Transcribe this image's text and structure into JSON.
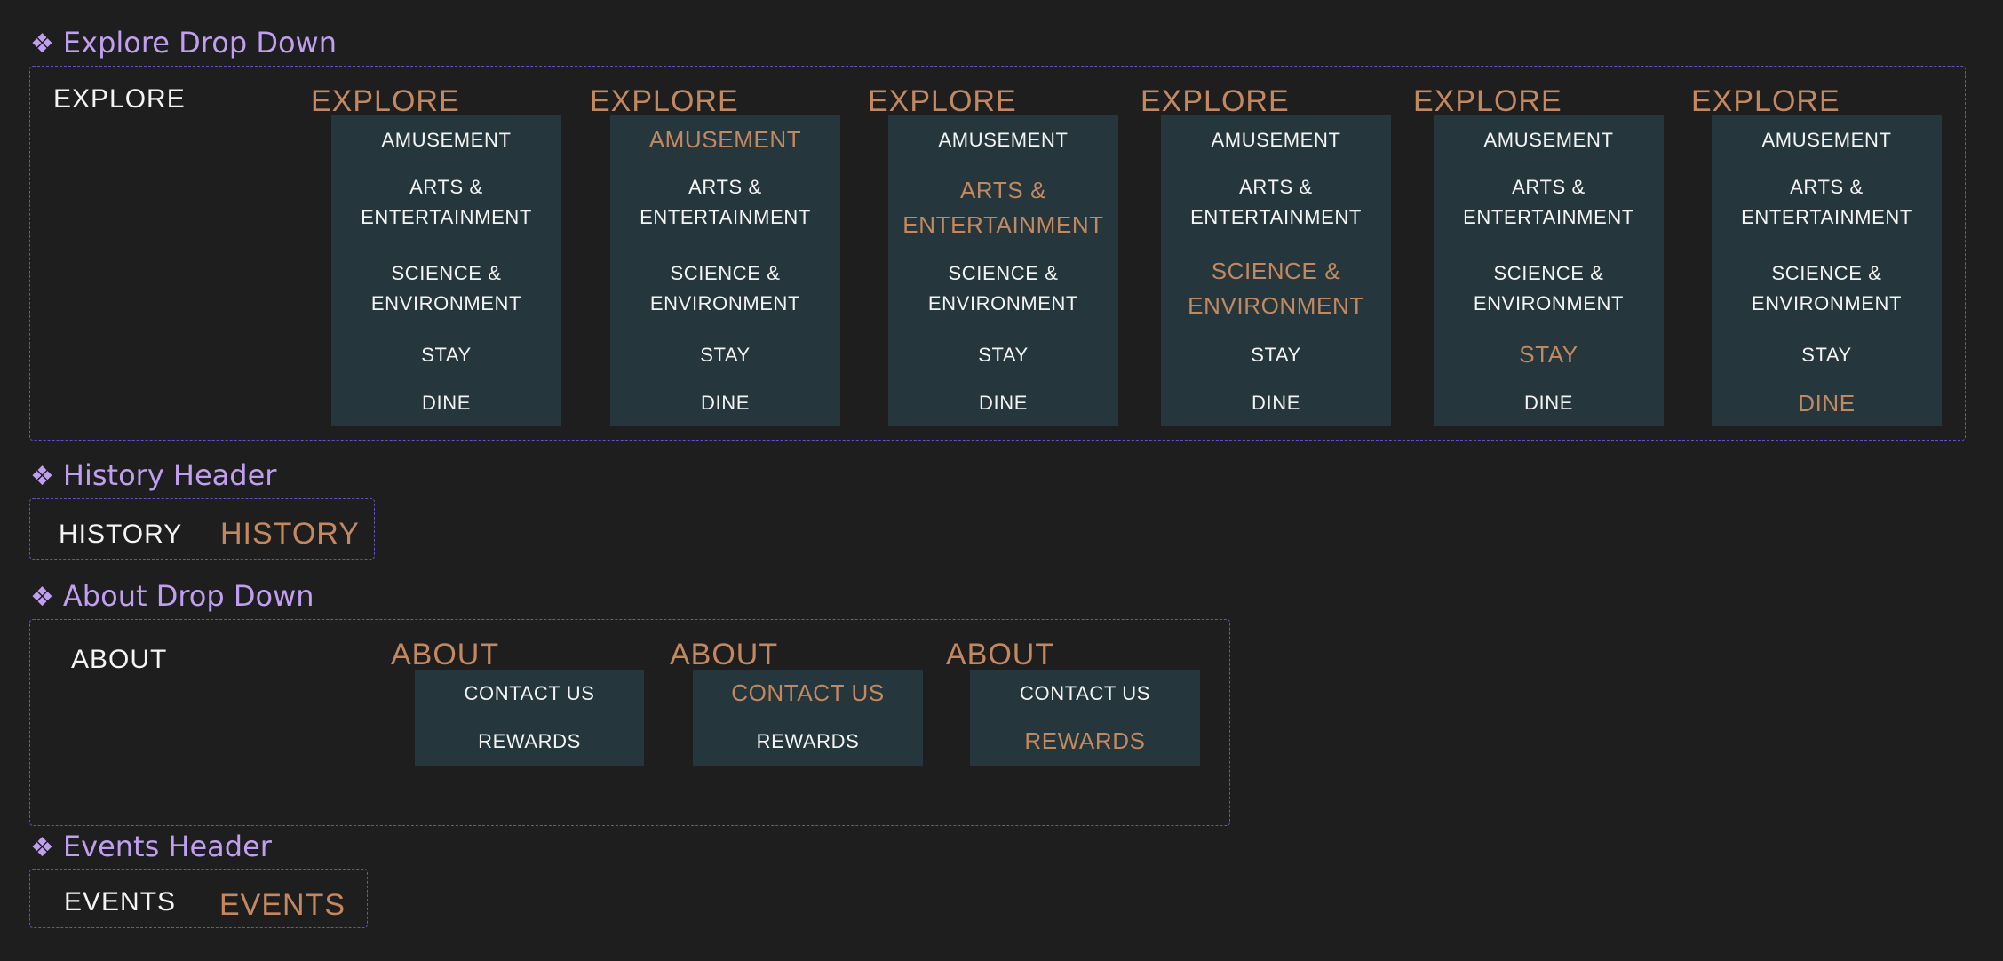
{
  "sections": {
    "explore": {
      "title": "Explore Drop Down",
      "default_label": "EXPLORE",
      "variants": [
        {
          "trigger": "EXPLORE",
          "items": [
            {
              "label": "AMUSEMENT"
            },
            {
              "label": "ARTS &\nENTERTAINMENT"
            },
            {
              "label": "SCIENCE &\nENVIRONMENT"
            },
            {
              "label": "STAY"
            },
            {
              "label": "DINE"
            }
          ]
        },
        {
          "trigger": "EXPLORE",
          "items": [
            {
              "label": "AMUSEMENT"
            },
            {
              "label": "ARTS &\nENTERTAINMENT"
            },
            {
              "label": "SCIENCE &\nENVIRONMENT"
            },
            {
              "label": "STAY"
            },
            {
              "label": "DINE"
            }
          ]
        },
        {
          "trigger": "EXPLORE",
          "items": [
            {
              "label": "AMUSEMENT"
            },
            {
              "label": "ARTS &\nENTERTAINMENT"
            },
            {
              "label": "SCIENCE &\nENVIRONMENT"
            },
            {
              "label": "STAY"
            },
            {
              "label": "DINE"
            }
          ]
        },
        {
          "trigger": "EXPLORE",
          "items": [
            {
              "label": "AMUSEMENT"
            },
            {
              "label": "ARTS &\nENTERTAINMENT"
            },
            {
              "label": "SCIENCE &\nENVIRONMENT"
            },
            {
              "label": "STAY"
            },
            {
              "label": "DINE"
            }
          ]
        },
        {
          "trigger": "EXPLORE",
          "items": [
            {
              "label": "AMUSEMENT"
            },
            {
              "label": "ARTS &\nENTERTAINMENT"
            },
            {
              "label": "SCIENCE &\nENVIRONMENT"
            },
            {
              "label": "STAY"
            },
            {
              "label": "DINE"
            }
          ]
        },
        {
          "trigger": "EXPLORE",
          "items": [
            {
              "label": "AMUSEMENT"
            },
            {
              "label": "ARTS &\nENTERTAINMENT"
            },
            {
              "label": "SCIENCE &\nENVIRONMENT"
            },
            {
              "label": "STAY"
            },
            {
              "label": "DINE"
            }
          ]
        }
      ]
    },
    "history": {
      "title": "History Header",
      "default_label": "HISTORY",
      "hover_label": "HISTORY"
    },
    "about": {
      "title": "About Drop Down",
      "default_label": "ABOUT",
      "variants": [
        {
          "trigger": "ABOUT",
          "items": [
            {
              "label": "CONTACT US"
            },
            {
              "label": "REWARDS"
            }
          ]
        },
        {
          "trigger": "ABOUT",
          "items": [
            {
              "label": "CONTACT US"
            },
            {
              "label": "REWARDS"
            }
          ]
        },
        {
          "trigger": "ABOUT",
          "items": [
            {
              "label": "CONTACT US"
            },
            {
              "label": "REWARDS"
            }
          ]
        }
      ]
    },
    "events": {
      "title": "Events Header",
      "default_label": "EVENTS",
      "hover_label": "EVENTS"
    }
  },
  "colors": {
    "background": "#1e1e1e",
    "section_title": "#c09ef0",
    "frame_border": "#6a4fc4",
    "menu_bg": "#25373c",
    "default_text": "#f4f4f4",
    "active_text": "#c48861"
  },
  "icons": {
    "component_marker": "component-diamond-icon",
    "component_marker_glyph": "❖"
  }
}
